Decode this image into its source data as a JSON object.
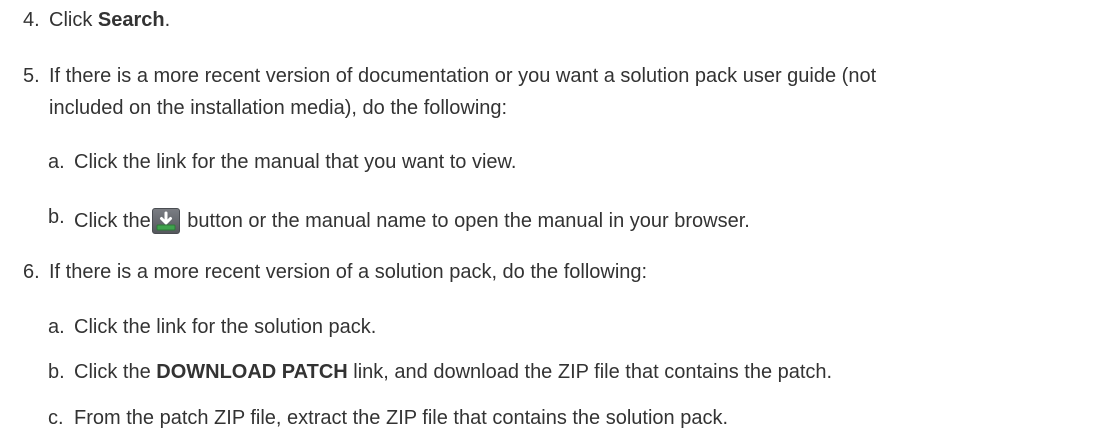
{
  "steps": [
    {
      "num": "4.",
      "pre": "Click ",
      "bold": "Search",
      "post": "."
    },
    {
      "num": "5.",
      "line1": "If there is a more recent version of documentation or you want a solution pack user guide (not",
      "line2": "included on the installation media), do the following:",
      "substeps": [
        {
          "letter": "a.",
          "text": "Click the link for the manual that you want to view."
        },
        {
          "letter": "b.",
          "pre": "Click the",
          "icon": "download-icon",
          "post": "button or the manual name to open the manual in your browser."
        }
      ]
    },
    {
      "num": "6.",
      "line1": "If there is a more recent version of a solution pack, do the following:",
      "substeps": [
        {
          "letter": "a.",
          "text": "Click the link for the solution pack."
        },
        {
          "letter": "b.",
          "pre": "Click the ",
          "bold": "DOWNLOAD PATCH",
          "post": " link, and download the ZIP file that contains the patch."
        },
        {
          "letter": "c.",
          "text": "From the patch ZIP file, extract the ZIP file that contains the solution pack."
        }
      ]
    }
  ]
}
